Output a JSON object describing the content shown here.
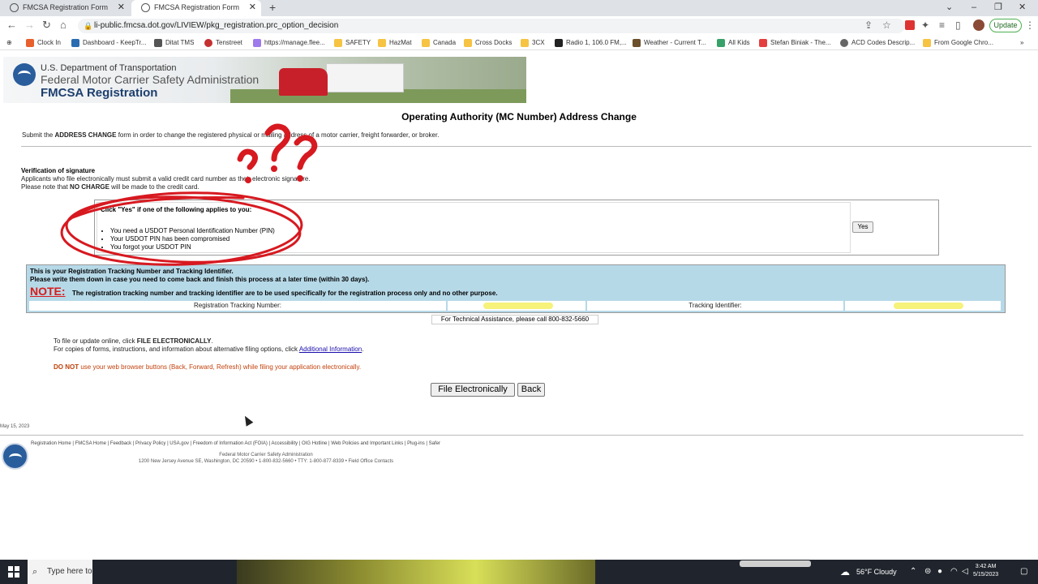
{
  "browser": {
    "tabs": [
      {
        "title": "FMCSA Registration Form",
        "active": false
      },
      {
        "title": "FMCSA Registration Form",
        "active": true
      }
    ],
    "new_tab": "+",
    "tab_close": "✕",
    "url": "li-public.fmcsa.dot.gov/LIVIEW/pkg_registration.prc_option_decision",
    "update_label": "Update",
    "ext_badge": "27",
    "bookmarks": [
      "Clock In",
      "Dashboard - KeepTr...",
      "Ditat TMS",
      "Tenstreet",
      "https://manage.flee...",
      "SAFETY",
      "HazMat",
      "Canada",
      "Cross Docks",
      "3CX",
      "Radio 1, 106.0 FM,...",
      "Weather - Current T...",
      "All Kids",
      "Stefan Biniak - The...",
      "ACD Codes Descrip...",
      "From Google Chro..."
    ]
  },
  "banner": {
    "line1": "U.S. Department of Transportation",
    "line2": "Federal Motor Carrier Safety Administration",
    "line3": "FMCSA Registration"
  },
  "page": {
    "title": "Operating Authority (MC Number) Address Change",
    "intro_pre": "Submit the ",
    "intro_bold": "ADDRESS CHANGE",
    "intro_post": " form in order to change the registered physical or mailing address of a motor carrier, freight forwarder, or broker.",
    "verif_title": "Verification of signature",
    "verif_line1": "Applicants who file electronically must submit a valid credit card number as their electronic signature.",
    "verif_line2_pre": "Please note that ",
    "verif_line2_bold": "NO CHARGE",
    "verif_line2_post": " will be made to the credit card.",
    "pin_heading": "Click \"Yes\" if one of the following applies to you:",
    "pin_items": [
      "You need a USDOT Personal Identification Number (PIN)",
      "Your USDOT PIN has been compromised",
      "You forgot your USDOT PIN"
    ],
    "yes_label": "Yes",
    "track_l1": "This is your Registration Tracking Number and Tracking Identifier.",
    "track_l2": "Please write them down in case you need to come back and finish this process at a later time (within 30 days).",
    "note_word": "NOTE:",
    "note_text": "The registration tracking number and tracking identifier are to be used specifically for the registration process only and no other purpose.",
    "reg_tracking_label": "Registration Tracking Number:",
    "tracking_id_label": "Tracking Identifier:",
    "tech_assist": "For Technical Assistance, please call 800-832-5660",
    "file_line1_pre": "To file or update online, click ",
    "file_line1_bold": "FILE ELECTRONICALLY",
    "file_line1_post": ".",
    "file_line2_pre": "For copies of forms, instructions, and information about alternative filing options, click ",
    "file_line2_link": "Additional Information",
    "file_line2_post": ".",
    "warn_bold": "DO NOT",
    "warn_text": " use your web browser buttons (Back, Forward, Refresh) while filing your application electronically.",
    "file_button": "File Electronically",
    "back_button": "Back",
    "date": "May 15, 2023"
  },
  "footer": {
    "links": "Registration Home | FMCSA Home | Feedback | Privacy Policy | USA.gov | Freedom of Information Act (FOIA) | Accessibility | OIG Hotline | Web Policies and Important Links | Plug-ins | Safer",
    "agency": "Federal Motor Carrier Safety Administration",
    "address": "1200 New Jersey Avenue SE, Washington, DC 20590 • 1-800-832-5660 • TTY: 1-800-877-8339 • Field Office Contacts"
  },
  "taskbar": {
    "search": "Type here to",
    "weather": "56°F  Cloudy",
    "time": "3:42 AM",
    "date": "5/15/2023"
  },
  "colors": {
    "annotation_red": "#d71920",
    "tracking_bg": "#b6d9e8",
    "highlight": "#f6f27a",
    "warning": "#c2410c"
  }
}
